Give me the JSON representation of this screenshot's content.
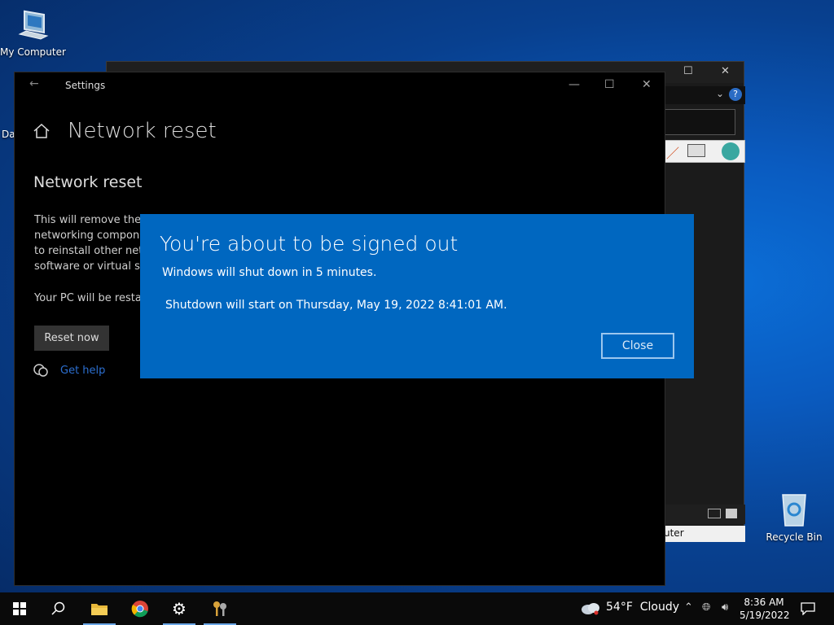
{
  "desktop": {
    "my_computer_label": "My Computer",
    "partial_label": "Da",
    "recycle_bin_label": "Recycle Bin"
  },
  "explorer": {
    "status_text": "uter"
  },
  "settings": {
    "window_title": "Settings",
    "page_title": "Network reset",
    "section_title": "Network reset",
    "description": "This will remove then\nnetworking compone\nto reinstall other netw\nsoftware or virtual sw",
    "restart_note": "Your PC will be restar",
    "reset_button": "Reset now",
    "help_link": "Get help"
  },
  "dialog": {
    "title": "You're about to be signed out",
    "line1": "Windows will shut down in 5 minutes.",
    "line2": "Shutdown will start on Thursday, May 19, 2022 8:41:01 AM.",
    "close_button": "Close"
  },
  "taskbar": {
    "weather": "54°F  Cloudy",
    "time": "8:36 AM",
    "date": "5/19/2022"
  },
  "colors": {
    "dialog_bg": "#0067c0",
    "accent_link": "#2c6fd0"
  }
}
